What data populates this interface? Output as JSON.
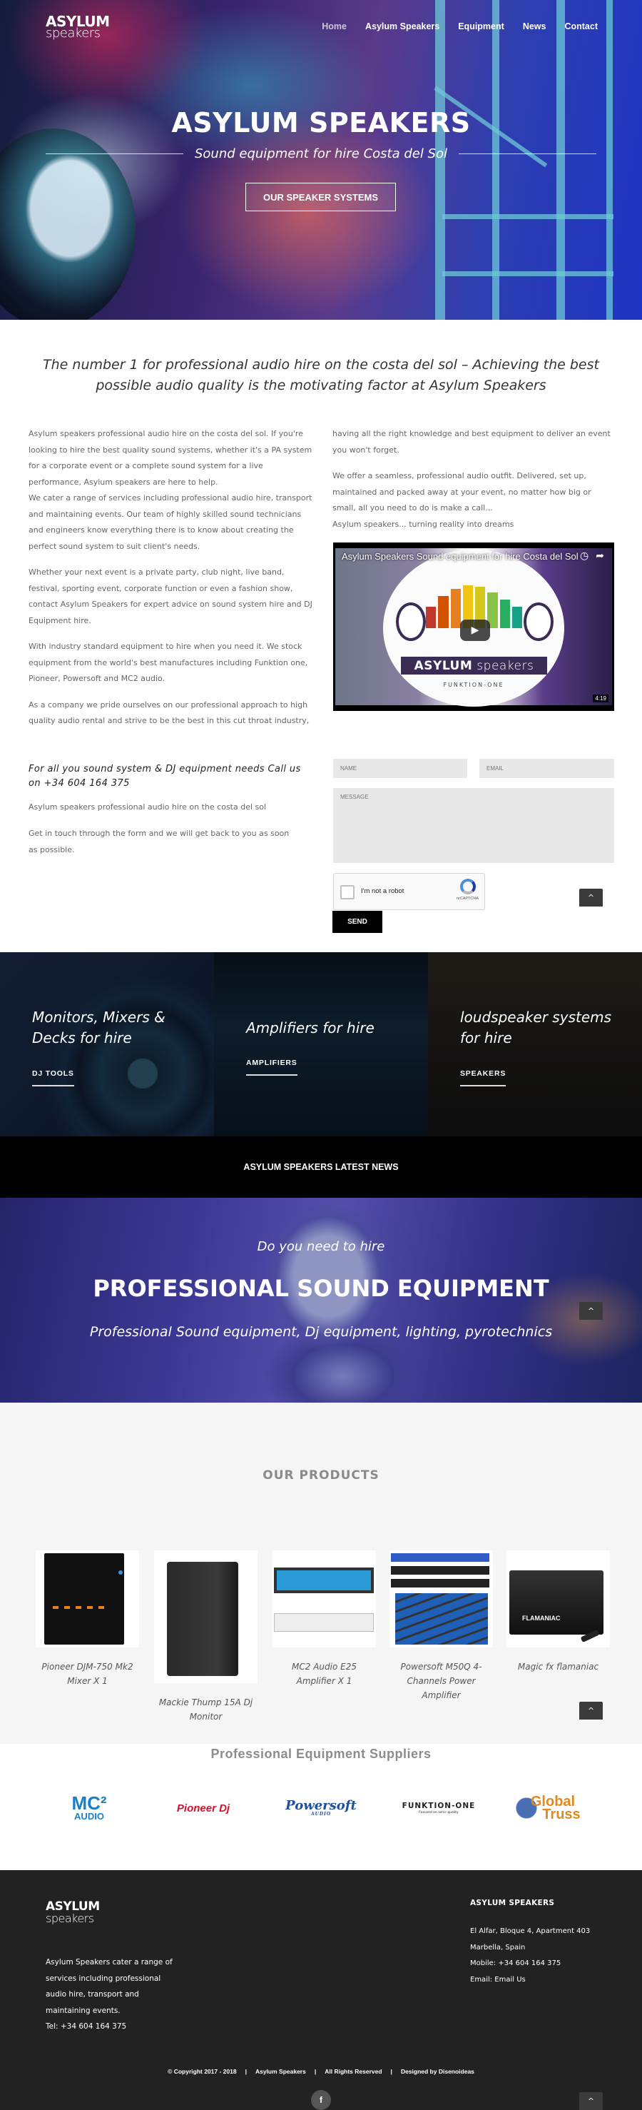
{
  "brand": {
    "logo_line1": "ASYLUM",
    "logo_line2": "speakers"
  },
  "nav": {
    "items": [
      {
        "label": "Home",
        "active": true
      },
      {
        "label": "Asylum Speakers"
      },
      {
        "label": "Equipment"
      },
      {
        "label": "News"
      },
      {
        "label": "Contact"
      }
    ]
  },
  "hero": {
    "title": "ASYLUM SPEAKERS",
    "subtitle": "Sound equipment for hire Costa del Sol",
    "button": "OUR SPEAKER SYSTEMS"
  },
  "intro": {
    "heading": "The number 1 for professional audio hire on the costa del sol – Achieving the best possible audio quality is the motivating factor at Asylum Speakers",
    "left_paragraphs": [
      "Asylum speakers professional audio hire on the costa del sol. If you're looking to hire the best quality sound systems, whether it's a PA system for a corporate event or a complete sound system for a live performance, Asylum speakers are here to help.\nWe cater a range of services including professional audio hire, transport and maintaining events. Our team of highly skilled sound technicians and engineers know everything there is to know about creating the perfect sound system to suit client's needs.",
      "Whether your next event is a private party, club night, live band, festival, sporting event, corporate function or even a fashion show, contact Asylum Speakers for expert advice on sound system hire and DJ Equipment hire.",
      "With industry standard equipment to hire when you need it. We stock equipment from the world's best manufactures including Funktion one, Pioneer, Powersoft and MC2 audio.",
      "As a company we pride ourselves on our professional approach to high quality audio rental and strive to be the best in this cut throat industry,"
    ],
    "right_paragraphs": [
      "having all the right knowledge and best equipment to deliver an event you won't forget.",
      "We offer a seamless, professional audio outfit. Delivered, set up, maintained and packed away at your event, no matter how big or small, all you need to do is make a call...\nAsylum speakers... turning reality into dreams"
    ],
    "video": {
      "title": "Asylum Speakers Sound equipment for hire Costa del Sol",
      "banner_bold": "ASYLUM",
      "banner_light": "speakers",
      "powered": "FUNKTION-ONE",
      "duration": "4:19",
      "icons": [
        "clock-icon",
        "share-icon"
      ]
    }
  },
  "contact": {
    "call_text": "For all you sound system & DJ equipment needs Call us on +34 604 164 375",
    "p1": "Asylum speakers professional audio hire on the costa del sol",
    "p2": "Get in touch through the form and we will get back to you as soon as possible.",
    "form": {
      "name_placeholder": "NAME",
      "email_placeholder": "EMAIL",
      "message_placeholder": "MESSAGE",
      "name_value": "",
      "email_value": "",
      "message_value": "",
      "captcha_label": "I'm not a robot",
      "captcha_brand": "reCAPTCHA",
      "send": "SEND"
    }
  },
  "categories": [
    {
      "title": "Monitors, Mixers & Decks for hire",
      "link": "DJ TOOLS"
    },
    {
      "title": "Amplifiers for hire",
      "link": "AMPLIFIERS"
    },
    {
      "title": "loudspeaker systems for hire",
      "link": "SPEAKERS"
    }
  ],
  "news_bar": "ASYLUM SPEAKERS LATEST NEWS",
  "promo": {
    "line1": "Do you need to hire",
    "line2": "PROFESSIONAL SOUND EQUIPMENT",
    "line3": "Professional Sound equipment, Dj equipment, lighting, pyrotechnics"
  },
  "products": {
    "title": "OUR PRODUCTS",
    "items": [
      {
        "name": "Pioneer DJM-750 Mk2 Mixer X 1"
      },
      {
        "name": "Mackie Thump 15A Dj Monitor"
      },
      {
        "name": "MC2 Audio E25 Amplifier X 1"
      },
      {
        "name": "Powersoft M50Q 4-Channels Power Amplifier"
      },
      {
        "name": "Magic fx flamaniac"
      }
    ]
  },
  "suppliers": {
    "title": "Professional Equipment Suppliers",
    "logos": [
      {
        "name": "MC2 AUDIO",
        "line1": "MC²",
        "line2": "AUDIO",
        "color": "#1a7fc8"
      },
      {
        "name": "Pioneer DJ",
        "line1": "Pioneer Dj",
        "color": "#d2102c"
      },
      {
        "name": "Powersoft Audio",
        "line1": "Powersoft",
        "line2": "AUDIO",
        "color": "#1d4ea0"
      },
      {
        "name": "Funktion-One",
        "line1": "FUNKTION-ONE",
        "line2": "Focused on sonic quality",
        "color": "#222222"
      },
      {
        "name": "Global Truss",
        "line1": "Global",
        "line2": "Truss",
        "color": "#e08a1e"
      }
    ]
  },
  "footer": {
    "about": "Asylum Speakers cater a range of services including professional audio hire, transport and maintaining events.",
    "tel": "Tel: +34 604 164 375",
    "contact_heading": "ASYLUM SPEAKERS",
    "address1": "El Alfar, Bloque 4, Apartment 403",
    "address2": "Marbella, Spain",
    "mobile": "Mobile: +34 604 164 375",
    "email": "Email: Email Us",
    "copyright": [
      "© Copyright 2017 - 2018",
      "|",
      "Asylum Speakers",
      "|",
      "All Rights Reserved",
      "|",
      "Designed by Disenoideas"
    ],
    "social": "f"
  },
  "scroll_top_icon": "^",
  "colors": {
    "accent_dark": "#222222",
    "field_bg": "#e8e8e8",
    "button_black": "#000000",
    "products_bg": "#f5f5f5"
  }
}
